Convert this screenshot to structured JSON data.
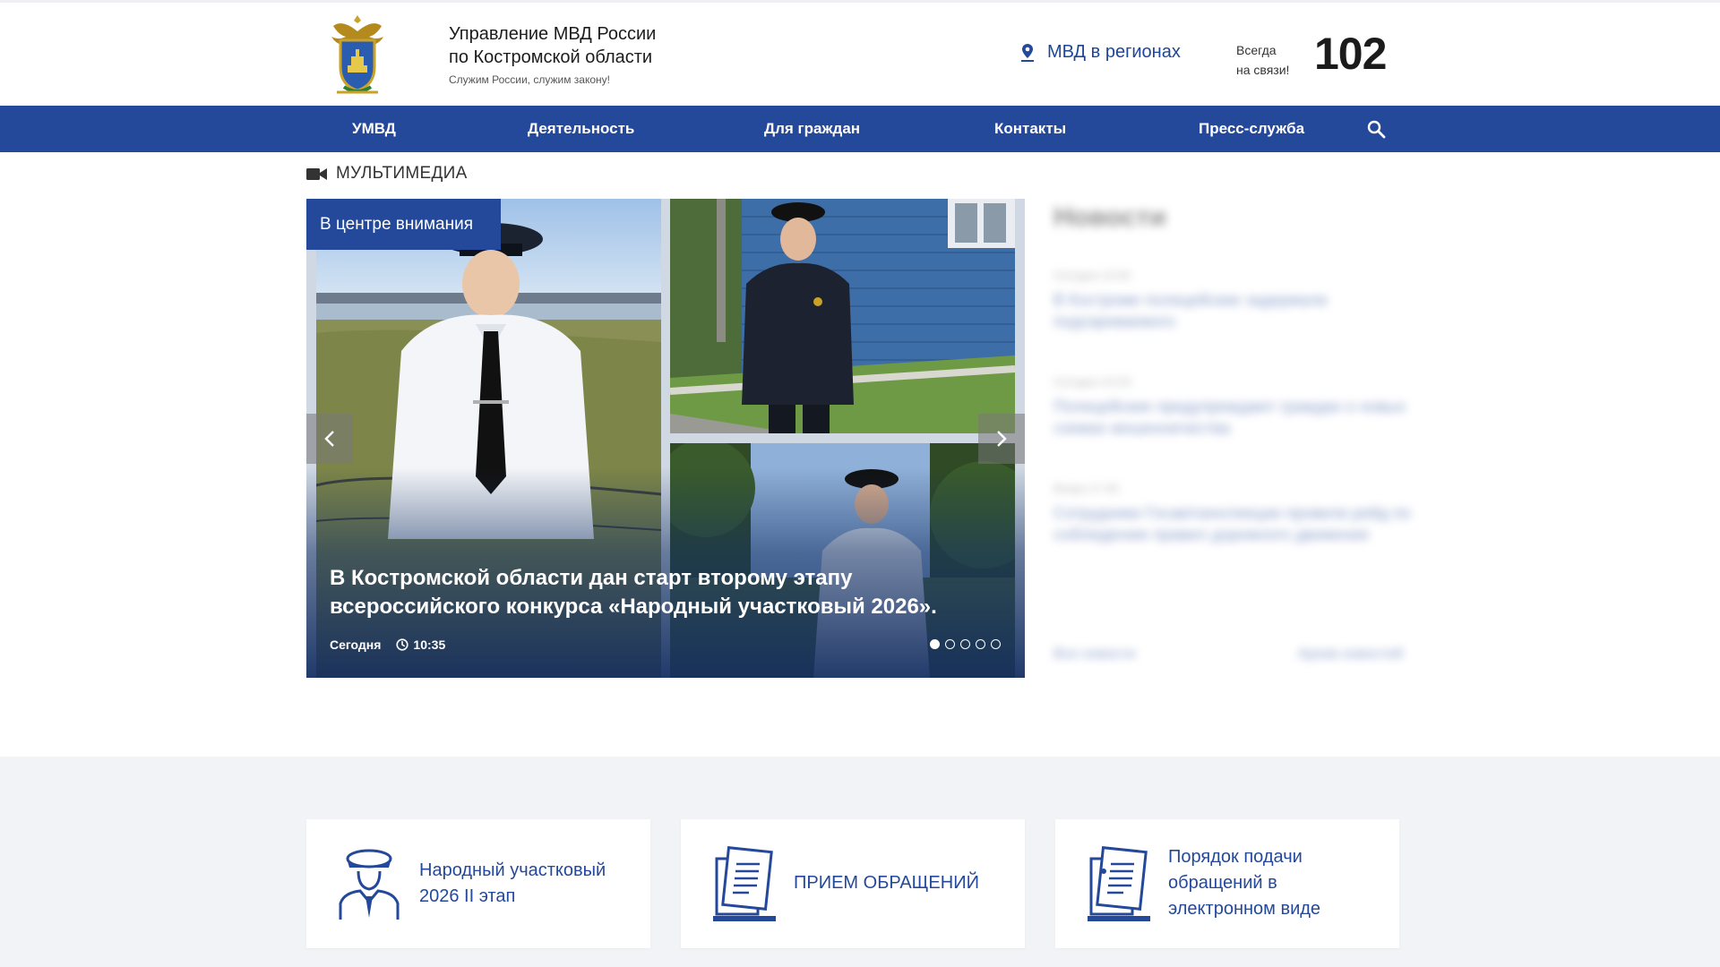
{
  "header": {
    "org_line1": "Управление МВД России",
    "org_line2": "по Костромской области",
    "slogan": "Служим России, служим закону!",
    "regions_label": "МВД в регионах",
    "always_line1": "Всегда",
    "always_line2": "на связи!",
    "phone": "102"
  },
  "nav": {
    "items": [
      {
        "label": "УМВД"
      },
      {
        "label": "Деятельность"
      },
      {
        "label": "Для граждан"
      },
      {
        "label": "Контакты"
      },
      {
        "label": "Пресс-служба"
      }
    ],
    "search_icon": "search-icon"
  },
  "multimedia": {
    "heading": "МУЛЬТИМЕДИА",
    "badge": "В центре внимания",
    "slide": {
      "title": "В Костромской области дан старт второму этапу всероссийского конкурса «Народный участковый 2026».",
      "day": "Сегодня",
      "time": "10:35"
    },
    "slide_count": 5,
    "active_slide": 1
  },
  "news": {
    "heading": "Новости",
    "items": [
      {
        "date": "Сегодня 12:00",
        "text": "В Костроме полицейские задержали подозреваемого"
      },
      {
        "date": "Сегодня 10:20",
        "text": "Полицейские предупреждают граждан о новых схемах мошенничества"
      },
      {
        "date": "Вчера 17:45",
        "text": "Сотрудники Госавтоинспекции провели рейд по соблюдению правил дорожного движения"
      }
    ],
    "all_news": "Все новости",
    "archive": "Архив новостей"
  },
  "cards": [
    {
      "line1": "Народный участковый",
      "line2": "2026 II этап",
      "icon": "officer-icon"
    },
    {
      "line1": "ПРИЕМ ОБРАЩЕНИЙ",
      "icon": "documents-icon"
    },
    {
      "line1": "Порядок подачи",
      "line2": "обращений в",
      "line3": "электронном виде",
      "icon": "e-documents-icon"
    }
  ],
  "colors": {
    "brand_blue": "#24489a",
    "band_bg": "#f2f3f6"
  }
}
